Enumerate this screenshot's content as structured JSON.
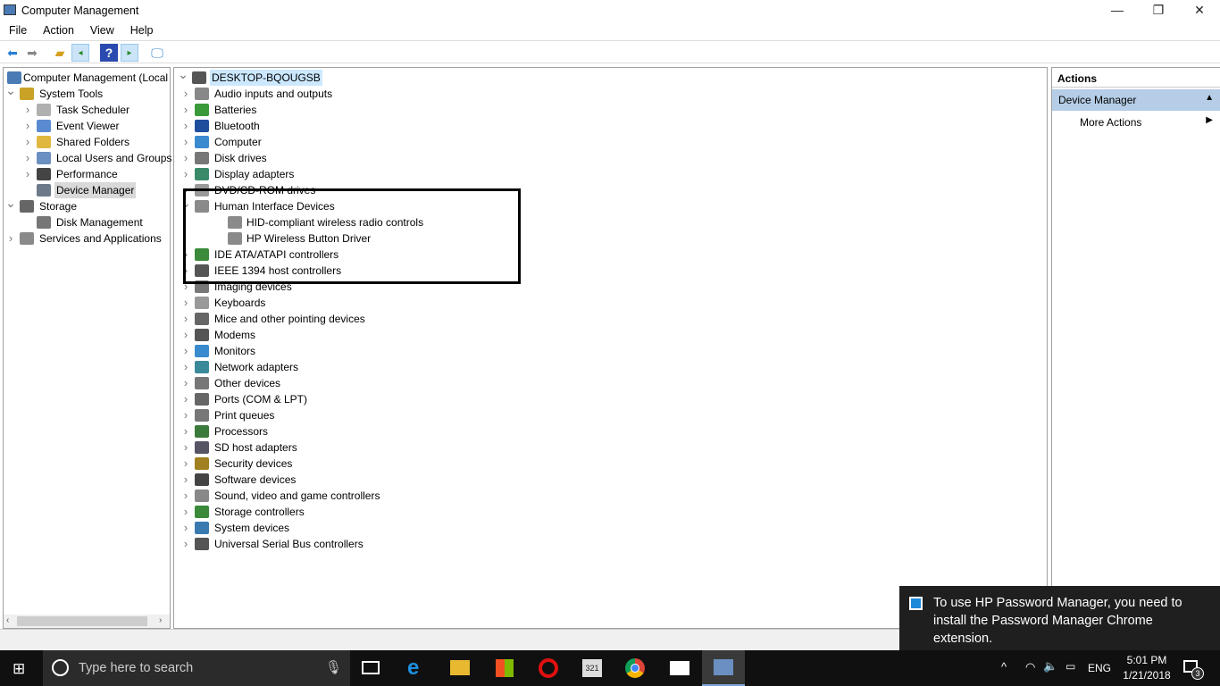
{
  "window": {
    "title": "Computer Management",
    "min": "—",
    "max": "❐",
    "close": "✕"
  },
  "menu": [
    "File",
    "Action",
    "View",
    "Help"
  ],
  "left_tree": [
    {
      "label": "Computer Management (Local",
      "level": 0,
      "chev": "",
      "icon": "#4a7bb5"
    },
    {
      "label": "System Tools",
      "level": 1,
      "chev": "v",
      "icon": "#c9a227"
    },
    {
      "label": "Task Scheduler",
      "level": 2,
      "chev": ">",
      "icon": "#b0b0b0"
    },
    {
      "label": "Event Viewer",
      "level": 2,
      "chev": ">",
      "icon": "#5a8bd0"
    },
    {
      "label": "Shared Folders",
      "level": 2,
      "chev": ">",
      "icon": "#e0b840"
    },
    {
      "label": "Local Users and Groups",
      "level": 2,
      "chev": ">",
      "icon": "#6a8fc0"
    },
    {
      "label": "Performance",
      "level": 2,
      "chev": ">",
      "icon": "#444"
    },
    {
      "label": "Device Manager",
      "level": 2,
      "chev": "",
      "icon": "#6c7a8a",
      "selected": true
    },
    {
      "label": "Storage",
      "level": 1,
      "chev": "v",
      "icon": "#666"
    },
    {
      "label": "Disk Management",
      "level": 2,
      "chev": "",
      "icon": "#777"
    },
    {
      "label": "Services and Applications",
      "level": 1,
      "chev": ">",
      "icon": "#8a8a8a"
    }
  ],
  "root": {
    "label": "DESKTOP-BQOUGSB"
  },
  "devices": [
    {
      "label": "Audio inputs and outputs",
      "level": 1,
      "chev": ">",
      "icon": "#888"
    },
    {
      "label": "Batteries",
      "level": 1,
      "chev": ">",
      "icon": "#3a9a3a"
    },
    {
      "label": "Bluetooth",
      "level": 1,
      "chev": ">",
      "icon": "#1e4e9c"
    },
    {
      "label": "Computer",
      "level": 1,
      "chev": ">",
      "icon": "#3a8ad0"
    },
    {
      "label": "Disk drives",
      "level": 1,
      "chev": ">",
      "icon": "#777"
    },
    {
      "label": "Display adapters",
      "level": 1,
      "chev": ">",
      "icon": "#3a8a6a"
    },
    {
      "label": "DVD/CD-ROM drives",
      "level": 1,
      "chev": ">",
      "icon": "#999"
    },
    {
      "label": "Human Interface Devices",
      "level": 1,
      "chev": "v",
      "icon": "#8a8a8a"
    },
    {
      "label": "HID-compliant wireless radio controls",
      "level": 2,
      "chev": "",
      "icon": "#8a8a8a"
    },
    {
      "label": "HP Wireless Button Driver",
      "level": 2,
      "chev": "",
      "icon": "#8a8a8a"
    },
    {
      "label": "IDE ATA/ATAPI controllers",
      "level": 1,
      "chev": ">",
      "icon": "#3a8a3a"
    },
    {
      "label": "IEEE 1394 host controllers",
      "level": 1,
      "chev": ">",
      "icon": "#555"
    },
    {
      "label": "Imaging devices",
      "level": 1,
      "chev": ">",
      "icon": "#777"
    },
    {
      "label": "Keyboards",
      "level": 1,
      "chev": ">",
      "icon": "#999"
    },
    {
      "label": "Mice and other pointing devices",
      "level": 1,
      "chev": ">",
      "icon": "#666"
    },
    {
      "label": "Modems",
      "level": 1,
      "chev": ">",
      "icon": "#555"
    },
    {
      "label": "Monitors",
      "level": 1,
      "chev": ">",
      "icon": "#3a8ad0"
    },
    {
      "label": "Network adapters",
      "level": 1,
      "chev": ">",
      "icon": "#3a8a9a"
    },
    {
      "label": "Other devices",
      "level": 1,
      "chev": ">",
      "icon": "#777"
    },
    {
      "label": "Ports (COM & LPT)",
      "level": 1,
      "chev": ">",
      "icon": "#666"
    },
    {
      "label": "Print queues",
      "level": 1,
      "chev": ">",
      "icon": "#777"
    },
    {
      "label": "Processors",
      "level": 1,
      "chev": ">",
      "icon": "#3a7a3a"
    },
    {
      "label": "SD host adapters",
      "level": 1,
      "chev": ">",
      "icon": "#556"
    },
    {
      "label": "Security devices",
      "level": 1,
      "chev": ">",
      "icon": "#a08020"
    },
    {
      "label": "Software devices",
      "level": 1,
      "chev": ">",
      "icon": "#444"
    },
    {
      "label": "Sound, video and game controllers",
      "level": 1,
      "chev": ">",
      "icon": "#888"
    },
    {
      "label": "Storage controllers",
      "level": 1,
      "chev": ">",
      "icon": "#3a8a3a"
    },
    {
      "label": "System devices",
      "level": 1,
      "chev": ">",
      "icon": "#3a7ab0"
    },
    {
      "label": "Universal Serial Bus controllers",
      "level": 1,
      "chev": ">",
      "icon": "#555"
    }
  ],
  "actions": {
    "header": "Actions",
    "section": "Device Manager",
    "more": "More Actions"
  },
  "toast": {
    "message": "To use HP Password Manager, you need to install the Password Manager Chrome extension."
  },
  "taskbar": {
    "search_placeholder": "Type here to search",
    "lang": "ENG",
    "time": "5:01 PM",
    "date": "1/21/2018",
    "notifications": "3"
  }
}
